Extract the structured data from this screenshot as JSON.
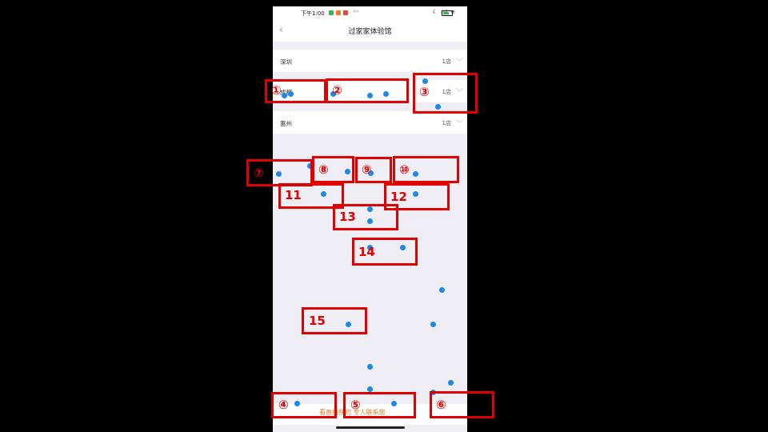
{
  "status_bar": {
    "time": "下午1:00",
    "more": "···",
    "right_indicators": "☾ ııl ≋"
  },
  "nav": {
    "back_glyph": "‹",
    "title": "过家家体验馆"
  },
  "cities": [
    {
      "name": "深圳",
      "count": "1店"
    },
    {
      "name": "成都",
      "count": "1店"
    },
    {
      "name": "惠州",
      "count": "1店"
    }
  ],
  "chevron_glyph": "⌵",
  "bottom_bar": {
    "text": "看直播预约 专人联系您"
  },
  "annotations": [
    "①",
    "②",
    "③",
    "④",
    "⑤",
    "⑥",
    "⑦",
    "⑧",
    "⑨",
    "⑩",
    "11",
    "12",
    "13",
    "14",
    "15"
  ],
  "colors": {
    "annotation_red": "#e00000",
    "marker_blue": "#1e88e5",
    "accent_orange": "#e07a1e",
    "page_bg": "#efeef4"
  }
}
